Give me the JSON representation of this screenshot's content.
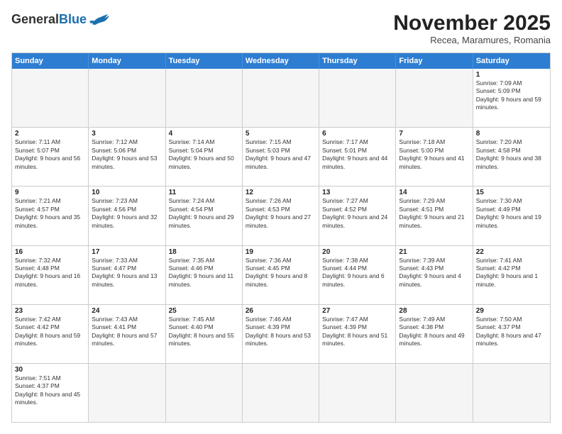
{
  "header": {
    "logo": {
      "general": "General",
      "blue": "Blue"
    },
    "title": "November 2025",
    "location": "Recea, Maramures, Romania"
  },
  "weekdays": [
    "Sunday",
    "Monday",
    "Tuesday",
    "Wednesday",
    "Thursday",
    "Friday",
    "Saturday"
  ],
  "rows": [
    [
      {
        "day": "",
        "info": ""
      },
      {
        "day": "",
        "info": ""
      },
      {
        "day": "",
        "info": ""
      },
      {
        "day": "",
        "info": ""
      },
      {
        "day": "",
        "info": ""
      },
      {
        "day": "",
        "info": ""
      },
      {
        "day": "1",
        "info": "Sunrise: 7:09 AM\nSunset: 5:09 PM\nDaylight: 9 hours and 59 minutes."
      }
    ],
    [
      {
        "day": "2",
        "info": "Sunrise: 7:11 AM\nSunset: 5:07 PM\nDaylight: 9 hours and 56 minutes."
      },
      {
        "day": "3",
        "info": "Sunrise: 7:12 AM\nSunset: 5:06 PM\nDaylight: 9 hours and 53 minutes."
      },
      {
        "day": "4",
        "info": "Sunrise: 7:14 AM\nSunset: 5:04 PM\nDaylight: 9 hours and 50 minutes."
      },
      {
        "day": "5",
        "info": "Sunrise: 7:15 AM\nSunset: 5:03 PM\nDaylight: 9 hours and 47 minutes."
      },
      {
        "day": "6",
        "info": "Sunrise: 7:17 AM\nSunset: 5:01 PM\nDaylight: 9 hours and 44 minutes."
      },
      {
        "day": "7",
        "info": "Sunrise: 7:18 AM\nSunset: 5:00 PM\nDaylight: 9 hours and 41 minutes."
      },
      {
        "day": "8",
        "info": "Sunrise: 7:20 AM\nSunset: 4:58 PM\nDaylight: 9 hours and 38 minutes."
      }
    ],
    [
      {
        "day": "9",
        "info": "Sunrise: 7:21 AM\nSunset: 4:57 PM\nDaylight: 9 hours and 35 minutes."
      },
      {
        "day": "10",
        "info": "Sunrise: 7:23 AM\nSunset: 4:56 PM\nDaylight: 9 hours and 32 minutes."
      },
      {
        "day": "11",
        "info": "Sunrise: 7:24 AM\nSunset: 4:54 PM\nDaylight: 9 hours and 29 minutes."
      },
      {
        "day": "12",
        "info": "Sunrise: 7:26 AM\nSunset: 4:53 PM\nDaylight: 9 hours and 27 minutes."
      },
      {
        "day": "13",
        "info": "Sunrise: 7:27 AM\nSunset: 4:52 PM\nDaylight: 9 hours and 24 minutes."
      },
      {
        "day": "14",
        "info": "Sunrise: 7:29 AM\nSunset: 4:51 PM\nDaylight: 9 hours and 21 minutes."
      },
      {
        "day": "15",
        "info": "Sunrise: 7:30 AM\nSunset: 4:49 PM\nDaylight: 9 hours and 19 minutes."
      }
    ],
    [
      {
        "day": "16",
        "info": "Sunrise: 7:32 AM\nSunset: 4:48 PM\nDaylight: 9 hours and 16 minutes."
      },
      {
        "day": "17",
        "info": "Sunrise: 7:33 AM\nSunset: 4:47 PM\nDaylight: 9 hours and 13 minutes."
      },
      {
        "day": "18",
        "info": "Sunrise: 7:35 AM\nSunset: 4:46 PM\nDaylight: 9 hours and 11 minutes."
      },
      {
        "day": "19",
        "info": "Sunrise: 7:36 AM\nSunset: 4:45 PM\nDaylight: 9 hours and 8 minutes."
      },
      {
        "day": "20",
        "info": "Sunrise: 7:38 AM\nSunset: 4:44 PM\nDaylight: 9 hours and 6 minutes."
      },
      {
        "day": "21",
        "info": "Sunrise: 7:39 AM\nSunset: 4:43 PM\nDaylight: 9 hours and 4 minutes."
      },
      {
        "day": "22",
        "info": "Sunrise: 7:41 AM\nSunset: 4:42 PM\nDaylight: 9 hours and 1 minute."
      }
    ],
    [
      {
        "day": "23",
        "info": "Sunrise: 7:42 AM\nSunset: 4:42 PM\nDaylight: 8 hours and 59 minutes."
      },
      {
        "day": "24",
        "info": "Sunrise: 7:43 AM\nSunset: 4:41 PM\nDaylight: 8 hours and 57 minutes."
      },
      {
        "day": "25",
        "info": "Sunrise: 7:45 AM\nSunset: 4:40 PM\nDaylight: 8 hours and 55 minutes."
      },
      {
        "day": "26",
        "info": "Sunrise: 7:46 AM\nSunset: 4:39 PM\nDaylight: 8 hours and 53 minutes."
      },
      {
        "day": "27",
        "info": "Sunrise: 7:47 AM\nSunset: 4:39 PM\nDaylight: 8 hours and 51 minutes."
      },
      {
        "day": "28",
        "info": "Sunrise: 7:49 AM\nSunset: 4:38 PM\nDaylight: 8 hours and 49 minutes."
      },
      {
        "day": "29",
        "info": "Sunrise: 7:50 AM\nSunset: 4:37 PM\nDaylight: 8 hours and 47 minutes."
      }
    ],
    [
      {
        "day": "30",
        "info": "Sunrise: 7:51 AM\nSunset: 4:37 PM\nDaylight: 8 hours and 45 minutes."
      },
      {
        "day": "",
        "info": ""
      },
      {
        "day": "",
        "info": ""
      },
      {
        "day": "",
        "info": ""
      },
      {
        "day": "",
        "info": ""
      },
      {
        "day": "",
        "info": ""
      },
      {
        "day": "",
        "info": ""
      }
    ]
  ]
}
